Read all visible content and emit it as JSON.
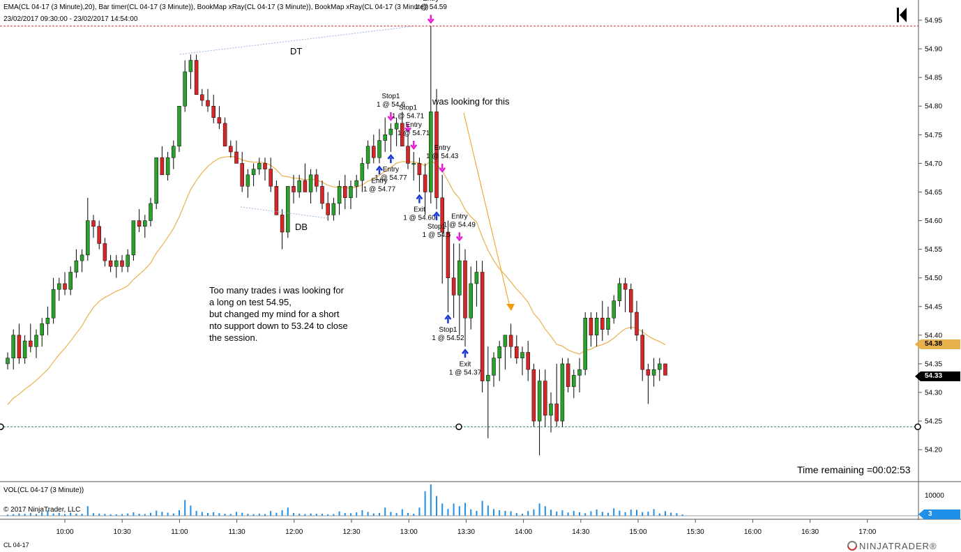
{
  "header": {
    "indicators": "EMA(CL 04-17 (3 Minute),20), Bar timer(CL 04-17 (3 Minute)), BookMap xRay(CL 04-17 (3 Minute)), BookMap xRay(CL 04-17 (3 Minute))",
    "range": "23/02/2017 09:30:00 - 23/02/2017 14:54:00"
  },
  "volume_panel": {
    "label": "VOL(CL 04-17 (3 Minute))",
    "copyright": "© 2017 NinjaTrader, LLC",
    "axis_label": "10000",
    "current": "3"
  },
  "footer": {
    "instrument": "CL 04-17",
    "brand": "NINJATRADER®"
  },
  "timer": "Time remaining =00:02:53",
  "annotations": {
    "dt": "DT",
    "db": "DB",
    "looking": "was looking for this",
    "note_lines": [
      "Too many trades i was looking for",
      "a long on test 54.95,",
      "but changed my mind for a short",
      "nto support down to 53.24 to close",
      "the session."
    ]
  },
  "colors": {
    "up": "#2ca02c",
    "down": "#d62728",
    "ema": "#e8b04a",
    "volume": "#1f8fe8",
    "buy_arrow": "#1a36d4",
    "sell_arrow": "#e61ed2",
    "price_line": "#d32f2f",
    "support": "#2e8b57"
  },
  "chart_data": {
    "type": "candlestick",
    "y_ticks": [
      "54.95",
      "54.90",
      "54.85",
      "54.80",
      "54.75",
      "54.70",
      "54.65",
      "54.60",
      "54.55",
      "54.50",
      "54.45",
      "54.40",
      "54.35",
      "54.30",
      "54.25",
      "54.20"
    ],
    "x_ticks": [
      "10:00",
      "10:30",
      "11:00",
      "11:30",
      "12:00",
      "12:30",
      "13:00",
      "13:30",
      "14:00",
      "14:30",
      "15:00",
      "15:30",
      "16:00",
      "16:30",
      "17:00"
    ],
    "ylim": [
      54.155,
      55.0
    ],
    "last_price": "54.33",
    "ema_value": "54.38",
    "resistance_line": 54.94,
    "support_line": 54.24,
    "ohlc": [
      [
        54.35,
        54.37,
        54.34,
        54.36
      ],
      [
        54.36,
        54.41,
        54.34,
        54.4
      ],
      [
        54.4,
        54.42,
        54.35,
        54.36
      ],
      [
        54.36,
        54.4,
        54.35,
        54.39
      ],
      [
        54.39,
        54.42,
        54.37,
        54.38
      ],
      [
        54.38,
        54.41,
        54.36,
        54.4
      ],
      [
        54.4,
        54.43,
        54.38,
        54.42
      ],
      [
        54.42,
        54.45,
        54.4,
        54.43
      ],
      [
        54.43,
        54.5,
        54.42,
        54.48
      ],
      [
        54.48,
        54.5,
        54.46,
        54.49
      ],
      [
        54.49,
        54.51,
        54.47,
        54.48
      ],
      [
        54.48,
        54.52,
        54.47,
        54.51
      ],
      [
        54.51,
        54.55,
        54.5,
        54.53
      ],
      [
        54.53,
        54.55,
        54.51,
        54.54
      ],
      [
        54.54,
        54.64,
        54.53,
        54.6
      ],
      [
        54.6,
        54.61,
        54.57,
        54.59
      ],
      [
        54.59,
        54.6,
        54.55,
        54.56
      ],
      [
        54.56,
        54.57,
        54.52,
        54.53
      ],
      [
        54.53,
        54.54,
        54.51,
        54.52
      ],
      [
        54.52,
        54.54,
        54.5,
        54.53
      ],
      [
        54.53,
        54.54,
        54.51,
        54.52
      ],
      [
        54.52,
        54.55,
        54.51,
        54.54
      ],
      [
        54.54,
        54.6,
        54.53,
        54.6
      ],
      [
        54.6,
        54.62,
        54.58,
        54.59
      ],
      [
        54.59,
        54.61,
        54.57,
        54.6
      ],
      [
        54.6,
        54.64,
        54.59,
        54.63
      ],
      [
        54.63,
        54.71,
        54.62,
        54.71
      ],
      [
        54.71,
        54.73,
        54.68,
        54.68
      ],
      [
        54.68,
        54.72,
        54.67,
        54.71
      ],
      [
        54.71,
        54.74,
        54.69,
        54.73
      ],
      [
        54.73,
        54.8,
        54.72,
        54.8
      ],
      [
        54.8,
        54.88,
        54.79,
        54.86
      ],
      [
        54.86,
        54.89,
        54.83,
        54.88
      ],
      [
        54.88,
        54.89,
        54.82,
        54.82
      ],
      [
        54.82,
        54.83,
        54.8,
        54.81
      ],
      [
        54.81,
        54.83,
        54.79,
        54.8
      ],
      [
        54.8,
        54.82,
        54.77,
        54.78
      ],
      [
        54.78,
        54.8,
        54.76,
        54.77
      ],
      [
        54.77,
        54.78,
        54.73,
        54.73
      ],
      [
        54.73,
        54.74,
        54.71,
        54.72
      ],
      [
        54.72,
        54.74,
        54.7,
        54.7
      ],
      [
        54.7,
        54.72,
        54.65,
        54.66
      ],
      [
        54.66,
        54.69,
        54.64,
        54.68
      ],
      [
        54.68,
        54.7,
        54.66,
        54.69
      ],
      [
        54.69,
        54.71,
        54.68,
        54.7
      ],
      [
        54.7,
        54.71,
        54.67,
        54.69
      ],
      [
        54.69,
        54.71,
        54.65,
        54.66
      ],
      [
        54.66,
        54.67,
        54.61,
        54.61
      ],
      [
        54.61,
        54.62,
        54.55,
        54.58
      ],
      [
        54.58,
        54.66,
        54.57,
        54.66
      ],
      [
        54.66,
        54.68,
        54.63,
        54.65
      ],
      [
        54.65,
        54.68,
        54.64,
        54.67
      ],
      [
        54.67,
        54.7,
        54.65,
        54.65
      ],
      [
        54.65,
        54.69,
        54.63,
        54.68
      ],
      [
        54.68,
        54.69,
        54.65,
        54.66
      ],
      [
        54.66,
        54.67,
        54.62,
        54.63
      ],
      [
        54.63,
        54.65,
        54.6,
        54.61
      ],
      [
        54.61,
        54.64,
        54.6,
        54.63
      ],
      [
        54.63,
        54.67,
        54.61,
        54.66
      ],
      [
        54.66,
        54.68,
        54.62,
        54.64
      ],
      [
        54.64,
        54.67,
        54.62,
        54.66
      ],
      [
        54.66,
        54.68,
        54.64,
        54.67
      ],
      [
        54.67,
        54.71,
        54.65,
        54.7
      ],
      [
        54.7,
        54.74,
        54.69,
        54.73
      ],
      [
        54.73,
        54.75,
        54.7,
        54.71
      ],
      [
        54.71,
        54.76,
        54.7,
        54.74
      ],
      [
        54.74,
        54.78,
        54.72,
        54.75
      ],
      [
        54.75,
        54.77,
        54.72,
        54.76
      ],
      [
        54.76,
        54.78,
        54.73,
        54.77
      ],
      [
        54.77,
        54.79,
        54.74,
        54.73
      ],
      [
        54.73,
        54.75,
        54.69,
        54.7
      ],
      [
        54.7,
        54.72,
        54.67,
        54.7
      ],
      [
        54.7,
        54.71,
        54.65,
        54.68
      ],
      [
        54.68,
        54.7,
        54.61,
        54.65
      ],
      [
        54.65,
        54.94,
        54.63,
        54.79
      ],
      [
        54.79,
        54.83,
        54.62,
        54.64
      ],
      [
        54.64,
        54.68,
        54.49,
        54.58
      ],
      [
        54.58,
        54.6,
        54.44,
        54.5
      ],
      [
        54.5,
        54.56,
        54.43,
        54.47
      ],
      [
        54.47,
        54.56,
        54.4,
        54.53
      ],
      [
        54.53,
        54.55,
        54.38,
        54.43
      ],
      [
        54.43,
        54.52,
        54.41,
        54.49
      ],
      [
        54.49,
        54.53,
        54.45,
        54.51
      ],
      [
        54.51,
        54.53,
        54.3,
        54.32
      ],
      [
        54.32,
        54.38,
        54.22,
        54.33
      ],
      [
        54.33,
        54.37,
        54.31,
        54.36
      ],
      [
        54.36,
        54.39,
        54.32,
        54.38
      ],
      [
        54.38,
        54.4,
        54.34,
        54.4
      ],
      [
        54.4,
        54.42,
        54.36,
        54.38
      ],
      [
        54.38,
        54.4,
        54.35,
        54.36
      ],
      [
        54.36,
        54.38,
        54.33,
        54.37
      ],
      [
        54.37,
        54.39,
        54.32,
        54.34
      ],
      [
        54.34,
        54.35,
        54.24,
        54.25
      ],
      [
        54.25,
        54.34,
        54.19,
        54.32
      ],
      [
        54.32,
        54.34,
        54.24,
        54.26
      ],
      [
        54.26,
        54.3,
        54.23,
        54.28
      ],
      [
        54.28,
        54.35,
        54.24,
        54.25
      ],
      [
        54.25,
        54.36,
        54.24,
        54.35
      ],
      [
        54.35,
        54.36,
        54.3,
        54.31
      ],
      [
        54.31,
        54.34,
        54.29,
        54.33
      ],
      [
        54.33,
        54.36,
        54.3,
        54.34
      ],
      [
        54.34,
        54.44,
        54.33,
        54.43
      ],
      [
        54.43,
        54.44,
        54.38,
        54.4
      ],
      [
        54.4,
        54.44,
        54.38,
        54.43
      ],
      [
        54.43,
        54.46,
        54.39,
        54.41
      ],
      [
        54.41,
        54.45,
        54.4,
        54.43
      ],
      [
        54.43,
        54.47,
        54.42,
        54.46
      ],
      [
        54.46,
        54.5,
        54.45,
        54.49
      ],
      [
        54.49,
        54.5,
        54.44,
        54.48
      ],
      [
        54.48,
        54.49,
        54.41,
        54.44
      ],
      [
        54.44,
        54.46,
        54.39,
        54.4
      ],
      [
        54.4,
        54.41,
        54.32,
        54.34
      ],
      [
        54.34,
        54.35,
        54.28,
        54.33
      ],
      [
        54.33,
        54.36,
        54.31,
        54.34
      ],
      [
        54.34,
        54.36,
        54.32,
        54.35
      ],
      [
        54.35,
        54.35,
        54.33,
        54.33
      ]
    ],
    "volume": [
      180,
      240,
      350,
      300,
      420,
      260,
      520,
      780,
      330,
      420,
      250,
      460,
      320,
      300,
      1400,
      380,
      320,
      280,
      220,
      210,
      250,
      340,
      500,
      300,
      260,
      440,
      760,
      580,
      460,
      340,
      820,
      2300,
      1500,
      720,
      560,
      420,
      520,
      380,
      300,
      260,
      560,
      440,
      300,
      240,
      320,
      260,
      700,
      440,
      800,
      1200,
      400,
      320,
      260,
      340,
      300,
      280,
      220,
      260,
      640,
      400,
      380,
      500,
      820,
      560,
      340,
      420,
      1200,
      560,
      400,
      960,
      420,
      300,
      1200,
      3600,
      4600,
      2900,
      1800,
      1000,
      1800,
      1400,
      1900,
      940,
      720,
      2200,
      1500,
      980,
      820,
      720,
      660,
      400,
      300,
      700,
      940,
      1800,
      1400,
      880,
      620,
      800,
      480,
      700,
      520,
      380,
      660,
      920,
      580,
      440,
      1080,
      760,
      520,
      900,
      880,
      540,
      600,
      980,
      340,
      680,
      460,
      380,
      200
    ],
    "orders": [
      {
        "label": "Entry",
        "price": "1 @ 54.59",
        "side": "sell",
        "bar": 74
      },
      {
        "label": "Stop1",
        "price": "1 @ 54.6",
        "side": "sell",
        "bar": 67
      },
      {
        "label": "Stop1",
        "price": "1 @ 54.71",
        "side": "sell",
        "bar": 70
      },
      {
        "label": "Entry",
        "price": "1 @ 54.71",
        "side": "sell",
        "bar": 71
      },
      {
        "label": "Entry",
        "price": "1 @ 54.77",
        "side": "buy",
        "bar": 67
      },
      {
        "label": "Entry",
        "price": "1 @ 54.77",
        "side": "buy",
        "bar": 65
      },
      {
        "label": "Entry",
        "price": "1 @ 54.43",
        "side": "sell",
        "bar": 76
      },
      {
        "label": "Exit",
        "price": "1 @ 54.60",
        "side": "buy",
        "bar": 72
      },
      {
        "label": "Entry",
        "price": "1 @ 54.49",
        "side": "sell",
        "bar": 79
      },
      {
        "label": "Stop1",
        "price": "1 @ 54.5",
        "side": "buy",
        "bar": 75
      },
      {
        "label": "Stop1",
        "price": "1 @ 54.52",
        "side": "buy",
        "bar": 77
      },
      {
        "label": "Exit",
        "price": "1 @ 54.37",
        "side": "buy",
        "bar": 80
      }
    ]
  }
}
